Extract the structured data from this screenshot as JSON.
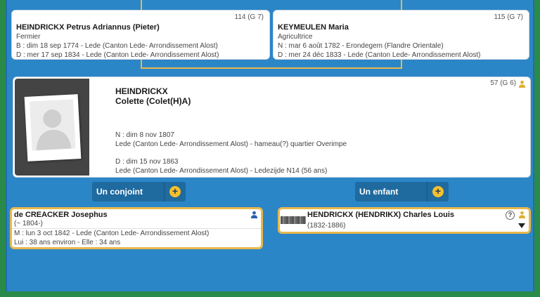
{
  "father": {
    "sosa": "114 (G 7)",
    "name": "HEINDRICKX Petrus Adriannus (Pieter)",
    "occupation": "Fermier",
    "birth": "B : dim 18 sep 1774 - Lede (Canton Lede- Arrondissement Alost)",
    "death": "D : mer 17 sep 1834 - Lede (Canton Lede- Arrondissement Alost)"
  },
  "mother": {
    "sosa": "115 (G 7)",
    "name": "KEYMEULEN Maria",
    "occupation": "Agricultrice",
    "birth": "N : mar 6 août 1782 - Erondegem (Flandre Orientale)",
    "death": "D : mer 24 déc 1833 - Lede (Canton Lede- Arrondissement Alost)"
  },
  "person": {
    "sosa": "57 (G 6)",
    "surname": "HEINDRICKX",
    "given": "Colette (Colet(H)A)",
    "birth_date": "N : dim 8 nov 1807",
    "birth_place": "Lede (Canton Lede- Arrondissement Alost) - hameau(?) quartier Overimpe",
    "death_date": "D : dim 15 nov 1863",
    "death_place": "Lede (Canton Lede- Arrondissement Alost) - Ledezijde N14 (56 ans)"
  },
  "buttons": {
    "spouse": "Un conjoint",
    "child": "Un enfant"
  },
  "spouse": {
    "name": "de CREACKER Josephus",
    "years": "(~ 1804-)",
    "marriage": "M : lun 3 oct 1842 - Lede (Canton Lede- Arrondissement Alost)",
    "ages": "Lui : 38 ans environ - Elle : 34 ans"
  },
  "child": {
    "name": "HENDRICKX (HENDRIKX) Charles Louis",
    "years": "(1832-1886)",
    "help": "?"
  },
  "colors": {
    "background": "#2b86c8",
    "accent": "#e8b84a",
    "button": "#1f6a9f",
    "male": "#2a5fb0",
    "female": "#e0b030"
  }
}
